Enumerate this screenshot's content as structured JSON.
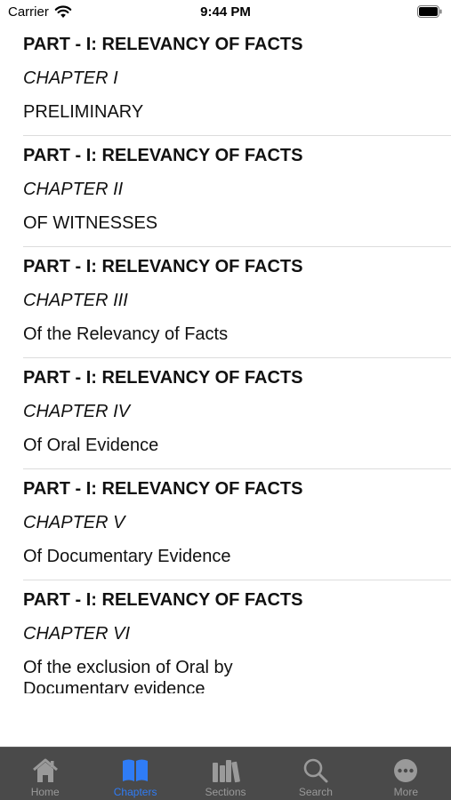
{
  "status_bar": {
    "carrier": "Carrier",
    "time": "9:44 PM"
  },
  "list": {
    "items": [
      {
        "part": "PART - I: RELEVANCY OF FACTS",
        "chapter": "CHAPTER I",
        "title": "PRELIMINARY"
      },
      {
        "part": "PART - I: RELEVANCY OF FACTS",
        "chapter": "CHAPTER II",
        "title": "OF WITNESSES"
      },
      {
        "part": "PART - I: RELEVANCY OF FACTS",
        "chapter": "CHAPTER III",
        "title": "Of the Relevancy of Facts"
      },
      {
        "part": "PART - I: RELEVANCY OF FACTS",
        "chapter": "CHAPTER IV",
        "title": "Of Oral Evidence"
      },
      {
        "part": "PART - I: RELEVANCY OF FACTS",
        "chapter": "CHAPTER V",
        "title": "Of Documentary Evidence"
      },
      {
        "part": "PART - I: RELEVANCY OF FACTS",
        "chapter": "CHAPTER VI",
        "title": "Of the exclusion of Oral by Documentary evidence"
      }
    ]
  },
  "tab_bar": {
    "active": "Chapters",
    "active_color": "#2f7cf6",
    "tabs": [
      {
        "label": "Home",
        "icon": "home-icon"
      },
      {
        "label": "Chapters",
        "icon": "book-icon"
      },
      {
        "label": "Sections",
        "icon": "books-icon"
      },
      {
        "label": "Search",
        "icon": "search-icon"
      },
      {
        "label": "More",
        "icon": "more-icon"
      }
    ]
  }
}
